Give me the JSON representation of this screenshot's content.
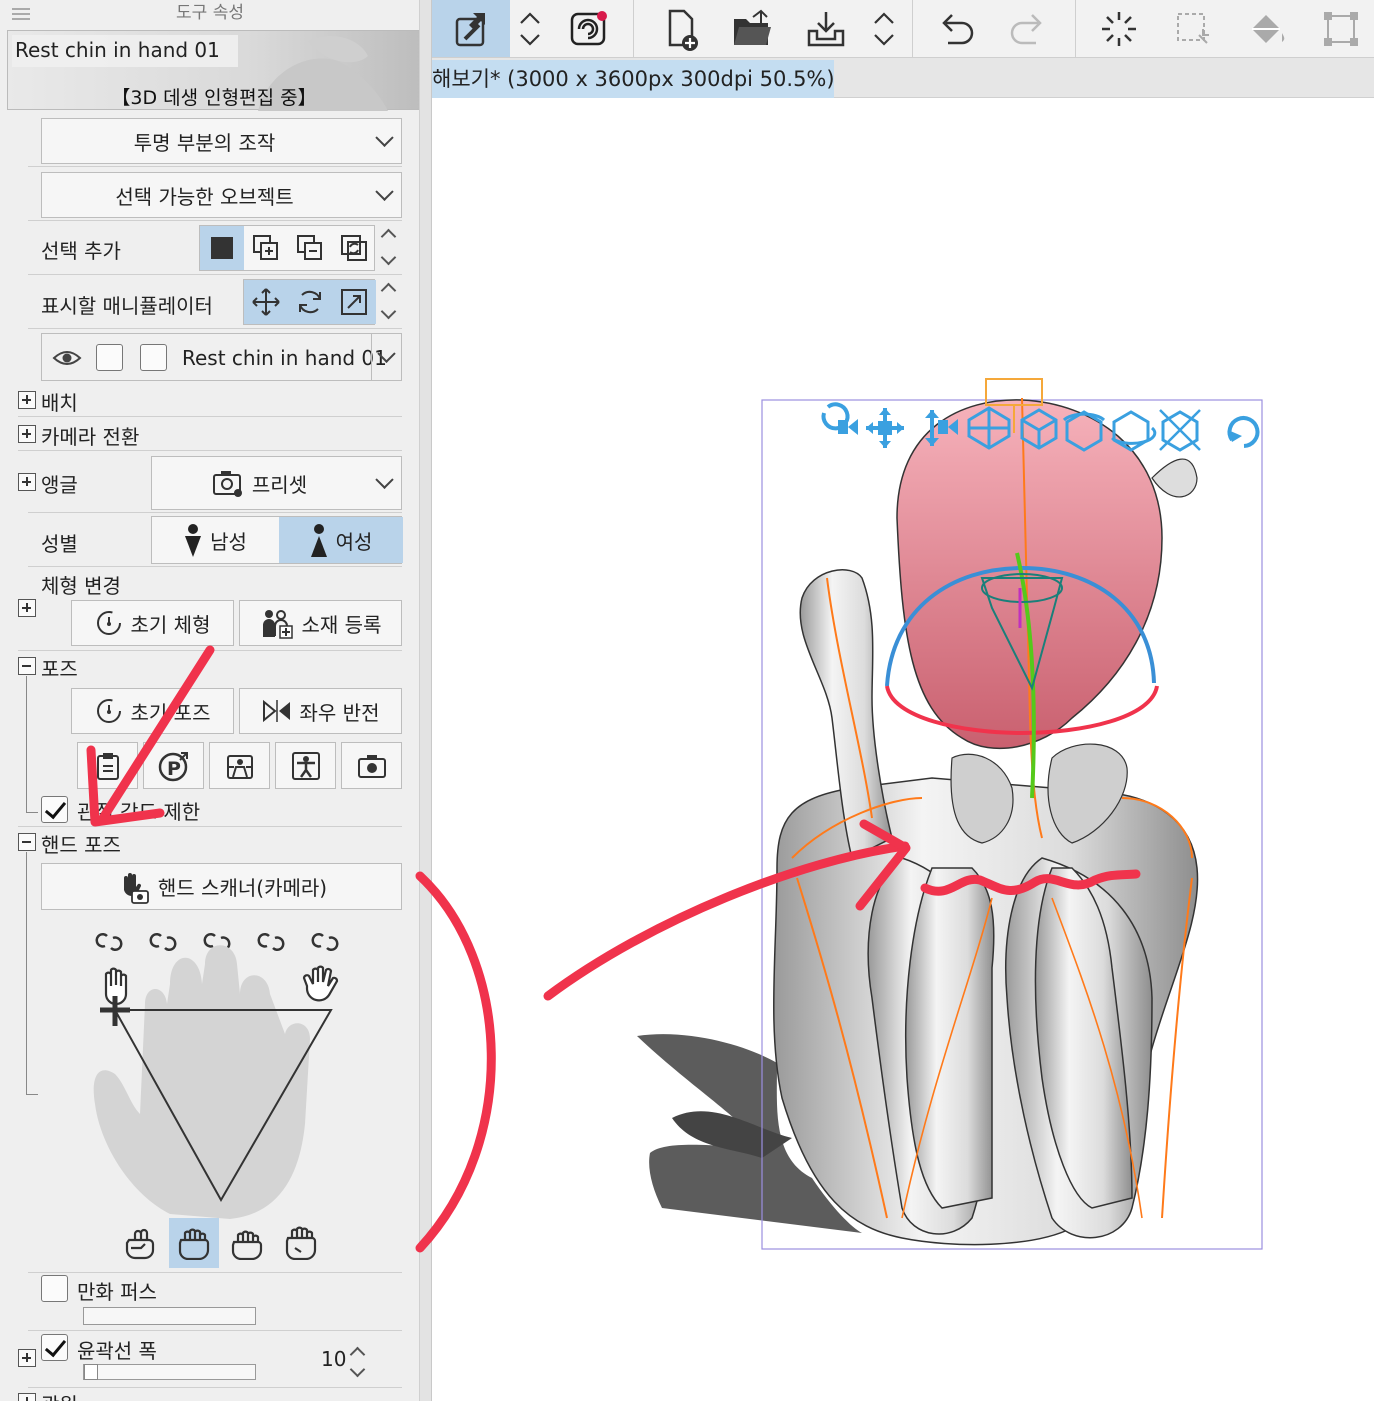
{
  "panel": {
    "title": "도구 속성",
    "preview_name": "Rest chin in hand 01",
    "preview_status": "【3D 데생 인형편집 중】",
    "transparent_op": "투명 부분의 조작",
    "selectable_obj": "선택 가능한 오브젝트",
    "add_selection_label": "선택 추가",
    "manipulator_label": "표시할 매니퓰레이터",
    "layer_name": "Rest chin in hand 01",
    "sections": {
      "placement": "배치",
      "camera_switch": "카메라 전환",
      "angle": "앵글",
      "angle_preset": "프리셋",
      "gender": "성별",
      "male": "남성",
      "female": "여성",
      "body_change": "체형 변경",
      "initial_body": "초기 체형",
      "register_material": "소재 등록",
      "pose": "포즈",
      "initial_pose": "초기 포즈",
      "flip_horizontal": "좌우 반전",
      "joint_limit": "관절 각도 제한",
      "hand_pose": "핸드 포즈",
      "hand_scanner": "핸드 스캐너(카메라)",
      "manga_perspective": "만화 퍼스",
      "outline_width": "윤곽선 폭",
      "outline_value": "10",
      "light": "광원"
    }
  },
  "toolbar": {
    "icons": [
      "object-tool-icon",
      "updown-icon",
      "clip-studio-icon",
      "new-file-icon",
      "open-folder-icon",
      "save-icon",
      "updown-icon",
      "undo-icon",
      "redo-icon",
      "loading-icon",
      "selection-area-icon",
      "fill-icon",
      "transform-icon"
    ]
  },
  "document_tab": "해보기* (3000 x 3600px 300dpi 50.5%)",
  "colors": {
    "accent_blue": "#b9d3ea",
    "annotation_red": "#f0334c",
    "manipulator_blue": "#3aa0e0",
    "head_pink": "#f2a3ad",
    "bbox_purple": "#9b8fe0"
  }
}
